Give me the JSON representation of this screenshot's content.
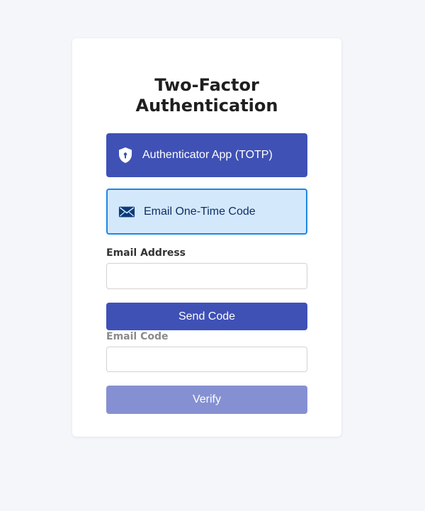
{
  "page": {
    "title": "Two-Factor Authentication"
  },
  "methods": [
    {
      "label": "Authenticator App (TOTP)",
      "icon": "shield-lock-icon",
      "selected": false
    },
    {
      "label": "Email One-Time Code",
      "icon": "envelope-icon",
      "selected": true
    }
  ],
  "email_form": {
    "address_label": "Email Address",
    "address_value": "",
    "address_placeholder": "",
    "send_label": "Send Code",
    "code_label": "Email Code",
    "code_value": "",
    "code_placeholder": "",
    "verify_label": "Verify"
  },
  "colors": {
    "primary": "#3f51b5",
    "selected_bg": "#d4e8fc",
    "selected_border": "#1e88e5",
    "disabled_button": "#8590d2",
    "page_bg": "#f4f6fa"
  }
}
